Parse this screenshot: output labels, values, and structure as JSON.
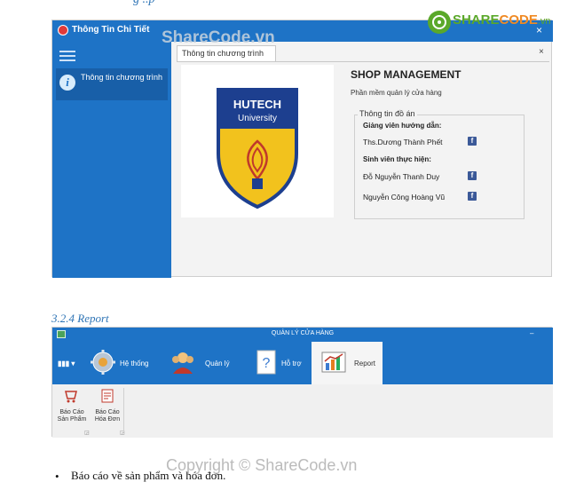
{
  "doc": {
    "top_heading_fragment": "g ..p",
    "section_heading": "3.2.4 Report",
    "bullet_text": "Báo cáo về sản phẩm và hóa đơn."
  },
  "window1": {
    "title": "Thông Tin Chi Tiết",
    "sidebar_item_label": "Thông tin chương trình",
    "tab_label": "Thông tin chương trình",
    "tab_close": "×",
    "logo": {
      "line1": "HUTECH",
      "line2": "University"
    },
    "shop_title": "SHOP MANAGEMENT",
    "shop_subtitle": "Phần mềm quản lý cửa hàng",
    "group_title": "Thông tin đồ án",
    "supervisor_heading": "Giảng viên hướng dẫn:",
    "supervisor_name": "Ths.Dương Thành Phết",
    "students_heading": "Sinh viên thực hiện:",
    "student1": "Đỗ Nguyễn Thanh Duy",
    "student2": "Nguyễn Công Hoàng Vũ",
    "fb_glyph": "f"
  },
  "window2": {
    "title": "QUẢN LÝ CỬA HÀNG",
    "minimize": "–",
    "menu_button": "▮▮▮ ▾",
    "tabs": [
      {
        "label": "Hệ thống",
        "icon": "gear-icon"
      },
      {
        "label": "Quản lý",
        "icon": "users-icon"
      },
      {
        "label": "Hỗ trợ",
        "icon": "help-icon"
      },
      {
        "label": "Report",
        "icon": "report-chart-icon"
      }
    ],
    "panel_items": [
      {
        "label": "Báo Cáo Sản Phẩm",
        "icon": "product-report-icon"
      },
      {
        "label": "Báo Cáo Hóa Đơn",
        "icon": "invoice-report-icon"
      }
    ]
  },
  "watermarks": {
    "top": "ShareCode.vn",
    "bottom": "Copyright © ShareCode.vn",
    "brand_share": "SHARE",
    "brand_code": "CODE",
    "brand_tld": ".vn"
  },
  "colors": {
    "title_blue": "#1e73c6",
    "heading_blue": "#2e74b5",
    "brand_green": "#5aa82a"
  }
}
